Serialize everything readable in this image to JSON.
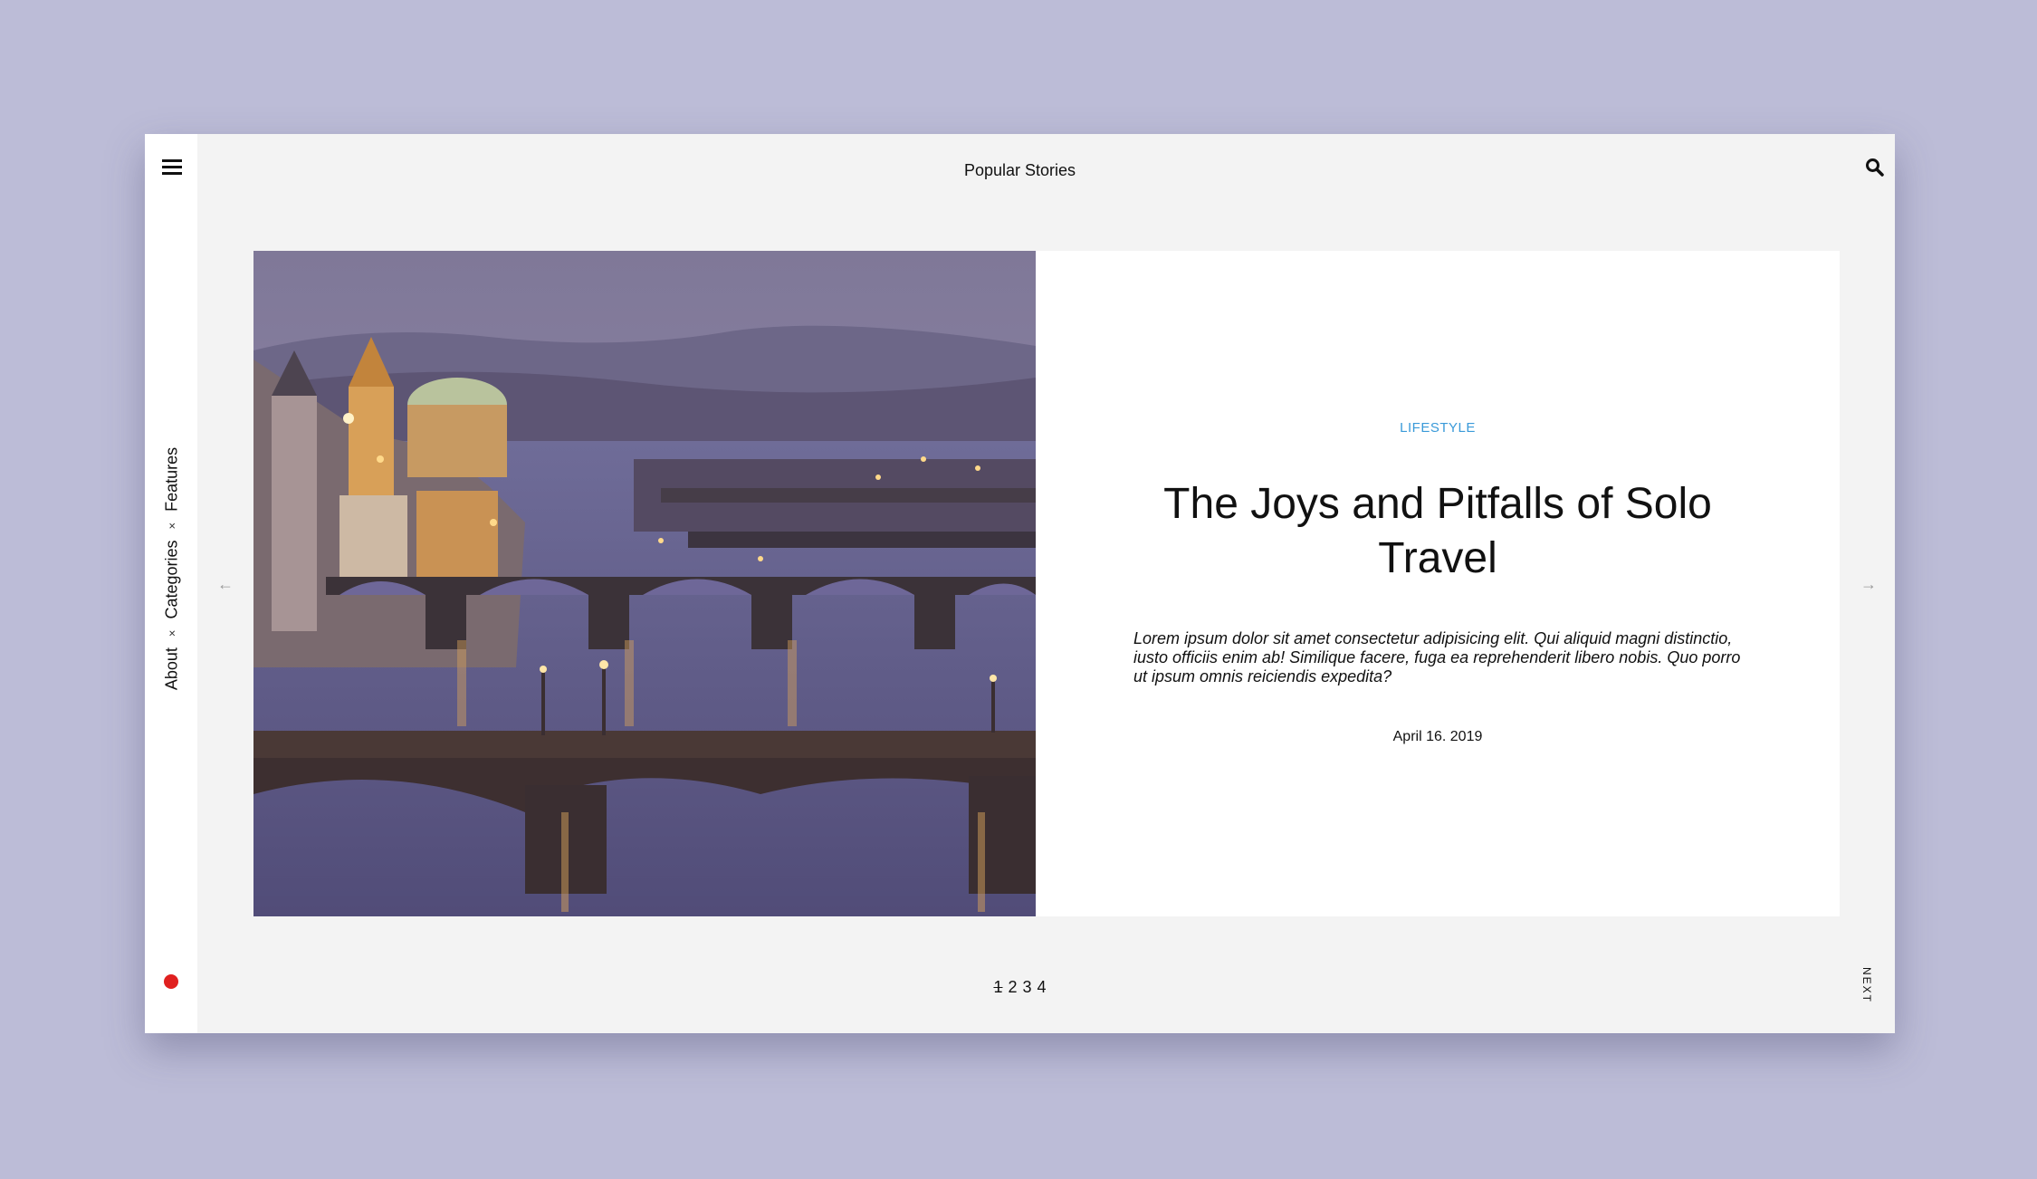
{
  "header": {
    "title": "Popular Stories"
  },
  "sidebar": {
    "items": [
      {
        "label": "About"
      },
      {
        "label": "Categories"
      },
      {
        "label": "Features"
      }
    ],
    "separator": "×",
    "indicator_color": "#e0201f"
  },
  "icons": {
    "menu": "hamburger-menu-icon",
    "search": "search-icon",
    "prev": "arrow-left-icon",
    "next": "arrow-right-icon"
  },
  "arrows": {
    "prev": "←",
    "next": "→"
  },
  "story": {
    "category": "LIFESTYLE",
    "title": "The Joys and Pitfalls of Solo Travel",
    "excerpt": "Lorem ipsum dolor sit amet consectetur adipisicing elit. Qui aliquid magni distinctio, iusto officiis enim ab! Similique facere, fuga ea reprehenderit libero nobis. Quo porro ut ipsum omnis reiciendis expedita?",
    "date": "April 16. 2019"
  },
  "pagination": {
    "pages": [
      "1",
      "2",
      "3",
      "4"
    ],
    "next_label": "NEXT"
  },
  "colors": {
    "background": "#bcbcd7",
    "accent": "#3a9ad9",
    "indicator": "#e0201f"
  }
}
